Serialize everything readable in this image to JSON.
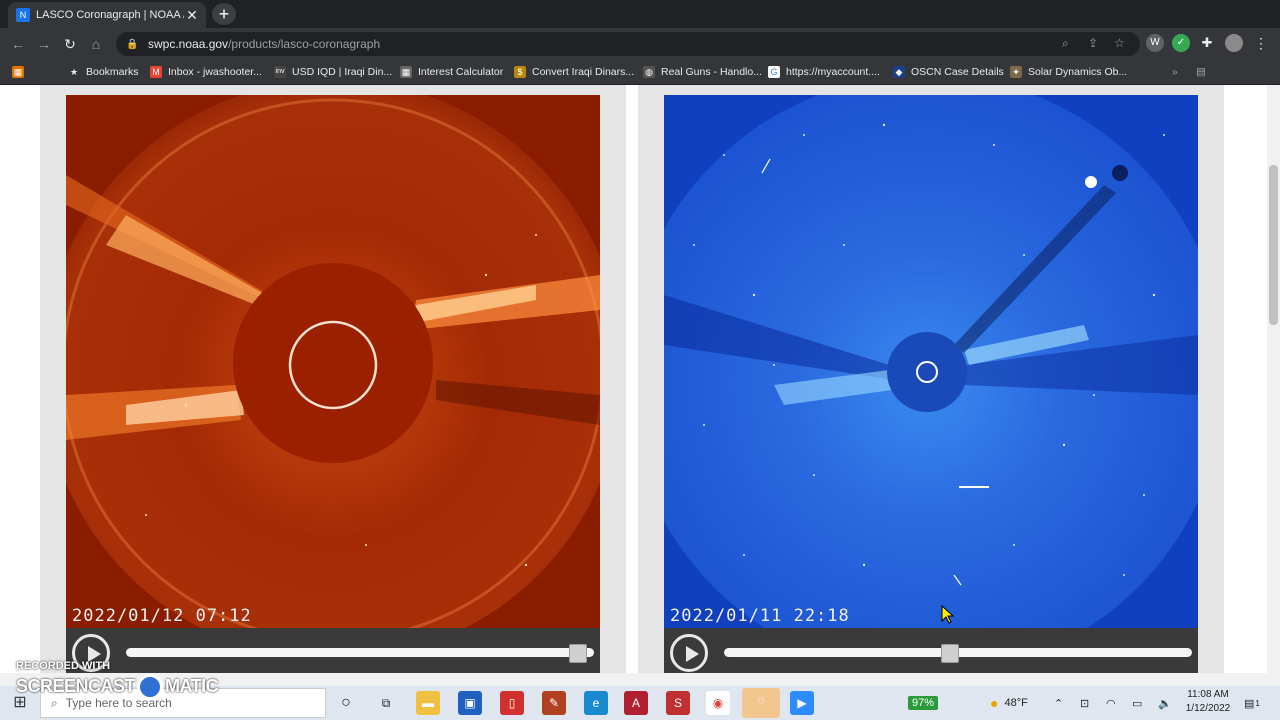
{
  "browser": {
    "tab_title": "LASCO Coronagraph | NOAA / N",
    "tab_close": "✕",
    "new_tab": "+",
    "url_host": "swpc.noaa.gov",
    "url_path": "/products/lasco-coronagraph"
  },
  "bookmarks": [
    {
      "label": "Bookmarks",
      "icon": "star-icon"
    },
    {
      "label": "Inbox - jwashooter...",
      "icon": "gmail-icon"
    },
    {
      "label": "USD IQD | Iraqi Din...",
      "icon": "investing-icon"
    },
    {
      "label": "Interest Calculator",
      "icon": "calculator-icon"
    },
    {
      "label": "Convert Iraqi Dinars...",
      "icon": "coins-icon"
    },
    {
      "label": "Real Guns - Handlo...",
      "icon": "globe-icon"
    },
    {
      "label": "https://myaccount....",
      "icon": "google-icon"
    },
    {
      "label": "OSCN Case Details",
      "icon": "shield-icon"
    },
    {
      "label": "Solar Dynamics Ob...",
      "icon": "satellite-icon"
    }
  ],
  "panels": [
    {
      "timestamp": "2022/01/12 07:12",
      "progress": 0.98,
      "instrument_color": "#a02000"
    },
    {
      "timestamp": "2022/01/11 22:18",
      "progress": 0.48,
      "instrument_color": "#1248c8"
    }
  ],
  "taskbar": {
    "search_placeholder": "Type here to search",
    "battery": "97%",
    "temperature": "48°F",
    "time": "11:08 AM",
    "date": "1/12/2022",
    "notification_count": "1"
  },
  "watermark": {
    "line1": "RECORDED WITH",
    "line2a": "SCREENCAST",
    "line2b": "MATIC"
  }
}
